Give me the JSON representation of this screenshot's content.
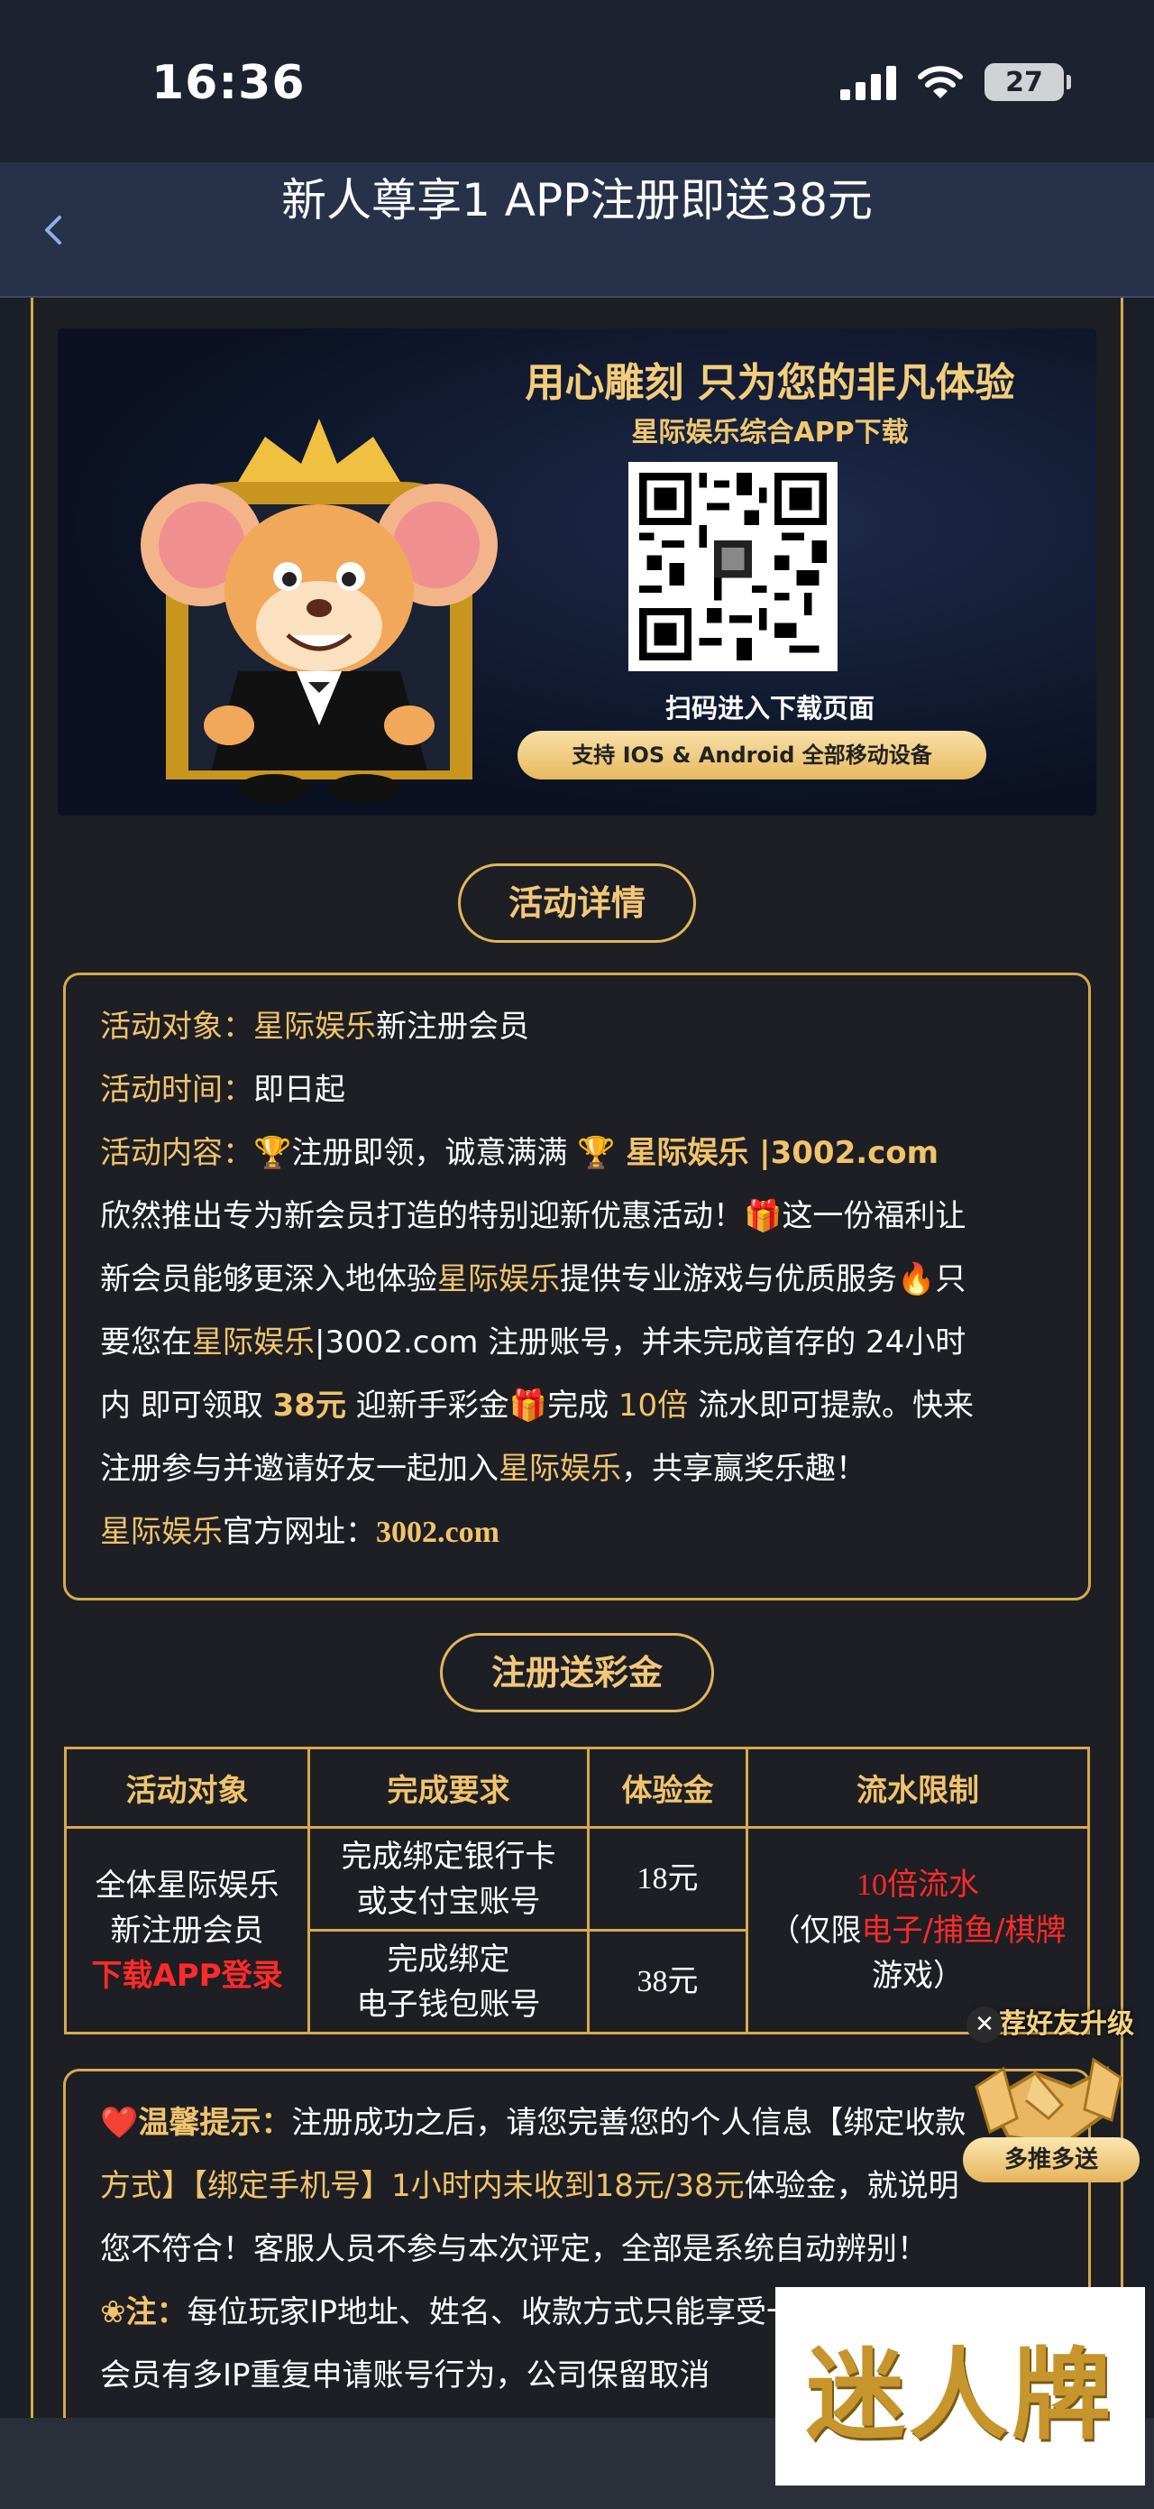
{
  "status_bar": {
    "time": "16:36",
    "battery": "27"
  },
  "nav": {
    "title": "新人尊享1 APP注册即送38元"
  },
  "banner": {
    "headline": "用心雕刻 只为您的非凡体验",
    "subtitle": "星际娱乐综合APP下载",
    "scan_text": "扫码进入下载页面",
    "support": "支持 IOS & Android 全部移动设备"
  },
  "details": {
    "pill": "活动详情",
    "target_label": "活动对象：",
    "target_brand": "星际娱乐",
    "target_text": "新注册会员",
    "time_label": "活动时间：",
    "time_value": "即日起",
    "content_label": "活动内容：",
    "c1_trophy": "🏆",
    "c1_a": "注册即领，诚意满满 ",
    "c1_trophy2": "🏆",
    "c1_brand": " 星际娱乐 |3002.com",
    "c2_a": "欣然推出专为新会员打造的特别迎新优惠活动！",
    "c2_gift": "🎁",
    "c2_b": "这一份福利让",
    "c3_a": "新会员能够更深入地体验",
    "c3_brand": "星际娱乐",
    "c3_b": "提供专业游戏与优质服务",
    "c3_fire": "🔥",
    "c3_c": "只",
    "c4_a": "要您在",
    "c4_brand": "星际娱乐",
    "c4_b": "|3002.com 注册账号，并未完成首存的 24小时",
    "c5_a": "内 即可领取 ",
    "c5_amount": "38元",
    "c5_b": " 迎新手彩金",
    "c5_gift": "🎁",
    "c5_c": "完成 ",
    "c5_times": "10倍",
    "c5_d": " 流水即可提款。快来",
    "c6_a": "注册参与并邀请好友一起加入",
    "c6_brand": "星际娱乐",
    "c6_b": "，共享赢奖乐趣！",
    "site_brand": "星际娱乐",
    "site_label": "官方网址：",
    "site_url": "3002.com"
  },
  "register": {
    "pill": "注册送彩金",
    "headers": [
      "活动对象",
      "完成要求",
      "体验金",
      "流水限制"
    ],
    "target_line1": "全体星际娱乐",
    "target_line2": "新注册会员",
    "target_cta": "下载APP登录",
    "req1_line1": "完成绑定银行卡",
    "req1_line2": "或支付宝账号",
    "bonus1": "18元",
    "req2_line1": "完成绑定",
    "req2_line2": "电子钱包账号",
    "bonus2": "38元",
    "limit_line1": "10倍流水",
    "limit_open": "（仅限",
    "limit_cats": "电子/捕鱼/棋牌",
    "limit_close": "游戏）"
  },
  "tips": {
    "heart": "❤️",
    "label": "温馨提示：",
    "l1": "注册成功之后，请您完善您的个人信息【绑定收款",
    "l2_a": "方式】【绑定手机号】1小时内未收到",
    "l2_amt": "18元/38元",
    "l2_b": "体验金，就说明",
    "l3": "您不符合！客服人员不参与本次评定，全部是系统自动辨别！",
    "note_icon": "❀",
    "note_label": "注：",
    "note_text": "每位玩家IP地址、姓名、收款方式只能享受一次，",
    "l5": "会员有多IP重复申请账号行为，公司保留取消"
  },
  "fab": {
    "title": "推荐好友升级",
    "close": "✕",
    "cta": "多推多送"
  },
  "watermark": {
    "text": "迷人牌"
  }
}
